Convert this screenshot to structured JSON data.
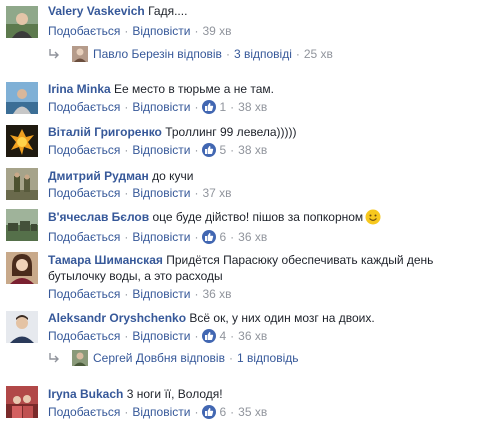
{
  "actions": {
    "like": "Подобається",
    "reply": "Відповісти",
    "dot": "·"
  },
  "comments": [
    {
      "author": "Valery Vaskevich",
      "text": "Гадя....",
      "time": "39 хв",
      "likes": ""
    },
    {
      "author": "Irina Minka",
      "text": "Ее место в тюрьме а не там.",
      "time": "38 хв",
      "likes": "1"
    },
    {
      "author": "Віталій Григоренко",
      "text": "Троллинг 99 левела)))))",
      "time": "38 хв",
      "likes": "5"
    },
    {
      "author": "Дмитрий Рудман",
      "text": "до кучи",
      "time": "37 хв",
      "likes": ""
    },
    {
      "author": "В'ячеслав Бєлов",
      "text": "оце буде дійство! пішов за попкорном",
      "time": "36 хв",
      "likes": "6"
    },
    {
      "author": "Тамара Шиманская",
      "text": "Придётся Парасюку обеспечивать каждый день",
      "text2": "бутылочку воды, а это расходы",
      "time": "36 хв",
      "likes": ""
    },
    {
      "author": "Aleksandr Oryshchenko",
      "text": "Всё ок, у них один мозг на двоих.",
      "time": "36 хв",
      "likes": "4"
    },
    {
      "author": "Iryna Bukach",
      "text": "3 ноги її, Володя!",
      "time": "35 хв",
      "likes": "6"
    }
  ],
  "replies": [
    {
      "name": "Павло Березін відповів",
      "count": "3 відповіді",
      "time": "25 хв"
    },
    {
      "name": "Сергей Довбня відповів",
      "count": "1 відповідь",
      "time": ""
    }
  ],
  "icons": {
    "like": "thumbs-up-icon",
    "reply": "reply-arrow-icon",
    "smile": "smiley-emoji-icon"
  },
  "colors": {
    "link": "#365899",
    "muted": "#90949c",
    "like_badge": "#4267b2"
  }
}
